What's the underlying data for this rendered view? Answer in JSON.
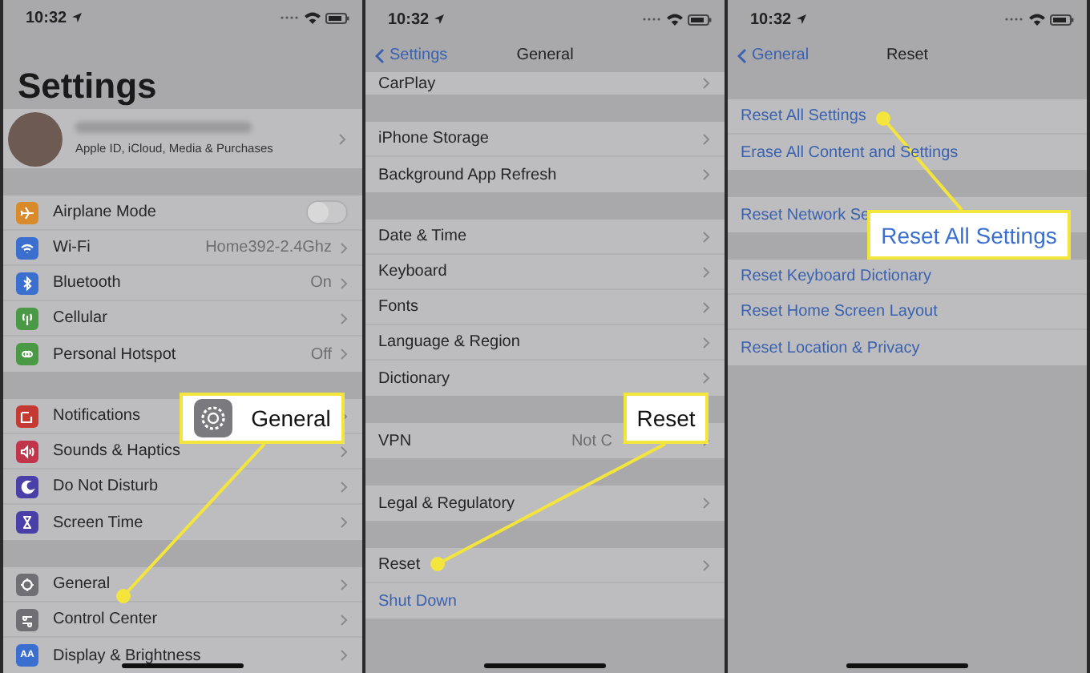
{
  "panels": [
    {
      "status": {
        "time": "10:32"
      },
      "header": {
        "kind": "large",
        "title": "Settings"
      },
      "profile": {
        "subtitle": "Apple ID, iCloud, Media & Purchases"
      },
      "groups": [
        {
          "rows": [
            {
              "kind": "switch",
              "label": "Airplane Mode",
              "color": "#d98a2b",
              "on": false
            },
            {
              "kind": "nav",
              "label": "Wi-Fi",
              "value": "Home392-2.4Ghz",
              "color": "#3a6fd0"
            },
            {
              "kind": "nav",
              "label": "Bluetooth",
              "value": "On",
              "color": "#3a6fd0"
            },
            {
              "kind": "nav",
              "label": "Cellular",
              "color": "#4a9a45"
            },
            {
              "kind": "nav",
              "label": "Personal Hotspot",
              "value": "Off",
              "color": "#4a9a45"
            }
          ]
        },
        {
          "rows": [
            {
              "kind": "nav",
              "label": "Notifications",
              "color": "#c43a33"
            },
            {
              "kind": "nav",
              "label": "Sounds & Haptics",
              "color": "#c2344a"
            },
            {
              "kind": "nav",
              "label": "Do Not Disturb",
              "color": "#4a3fa8"
            },
            {
              "kind": "nav",
              "label": "Screen Time",
              "color": "#4a3fa8"
            }
          ]
        },
        {
          "rows": [
            {
              "kind": "nav",
              "label": "General",
              "color": "#707074"
            },
            {
              "kind": "nav",
              "label": "Control Center",
              "color": "#707074"
            },
            {
              "kind": "nav",
              "label": "Display & Brightness",
              "color": "#3a6fd0",
              "icon_text": "AA"
            }
          ]
        }
      ],
      "callout": {
        "label": "General",
        "icon": true
      }
    },
    {
      "status": {
        "time": "10:32"
      },
      "header": {
        "kind": "nav",
        "back": "Settings",
        "title": "General"
      },
      "groups": [
        {
          "rows": [
            {
              "kind": "nav",
              "label": "CarPlay"
            }
          ]
        },
        {
          "rows": [
            {
              "kind": "nav",
              "label": "iPhone Storage"
            },
            {
              "kind": "nav",
              "label": "Background App Refresh"
            }
          ]
        },
        {
          "rows": [
            {
              "kind": "nav",
              "label": "Date & Time"
            },
            {
              "kind": "nav",
              "label": "Keyboard"
            },
            {
              "kind": "nav",
              "label": "Fonts"
            },
            {
              "kind": "nav",
              "label": "Language & Region"
            },
            {
              "kind": "nav",
              "label": "Dictionary"
            }
          ]
        },
        {
          "rows": [
            {
              "kind": "nav",
              "label": "VPN",
              "value": "Not C"
            }
          ]
        },
        {
          "rows": [
            {
              "kind": "nav",
              "label": "Legal & Regulatory"
            }
          ]
        },
        {
          "rows": [
            {
              "kind": "nav",
              "label": "Reset"
            },
            {
              "kind": "action",
              "label": "Shut Down"
            }
          ]
        }
      ],
      "callout": {
        "label": "Reset",
        "icon": false
      }
    },
    {
      "status": {
        "time": "10:32"
      },
      "header": {
        "kind": "nav",
        "back": "General",
        "title": "Reset"
      },
      "groups": [
        {
          "rows": [
            {
              "kind": "action",
              "label": "Reset All Settings"
            },
            {
              "kind": "action",
              "label": "Erase All Content and Settings"
            }
          ]
        },
        {
          "rows": [
            {
              "kind": "action",
              "label": "Reset Network Se"
            }
          ]
        },
        {
          "rows": [
            {
              "kind": "action",
              "label": "Reset Keyboard Dictionary"
            },
            {
              "kind": "action",
              "label": "Reset Home Screen Layout"
            },
            {
              "kind": "action",
              "label": "Reset Location & Privacy"
            }
          ]
        }
      ],
      "callout": {
        "label": "Reset All Settings",
        "icon": false
      }
    }
  ]
}
